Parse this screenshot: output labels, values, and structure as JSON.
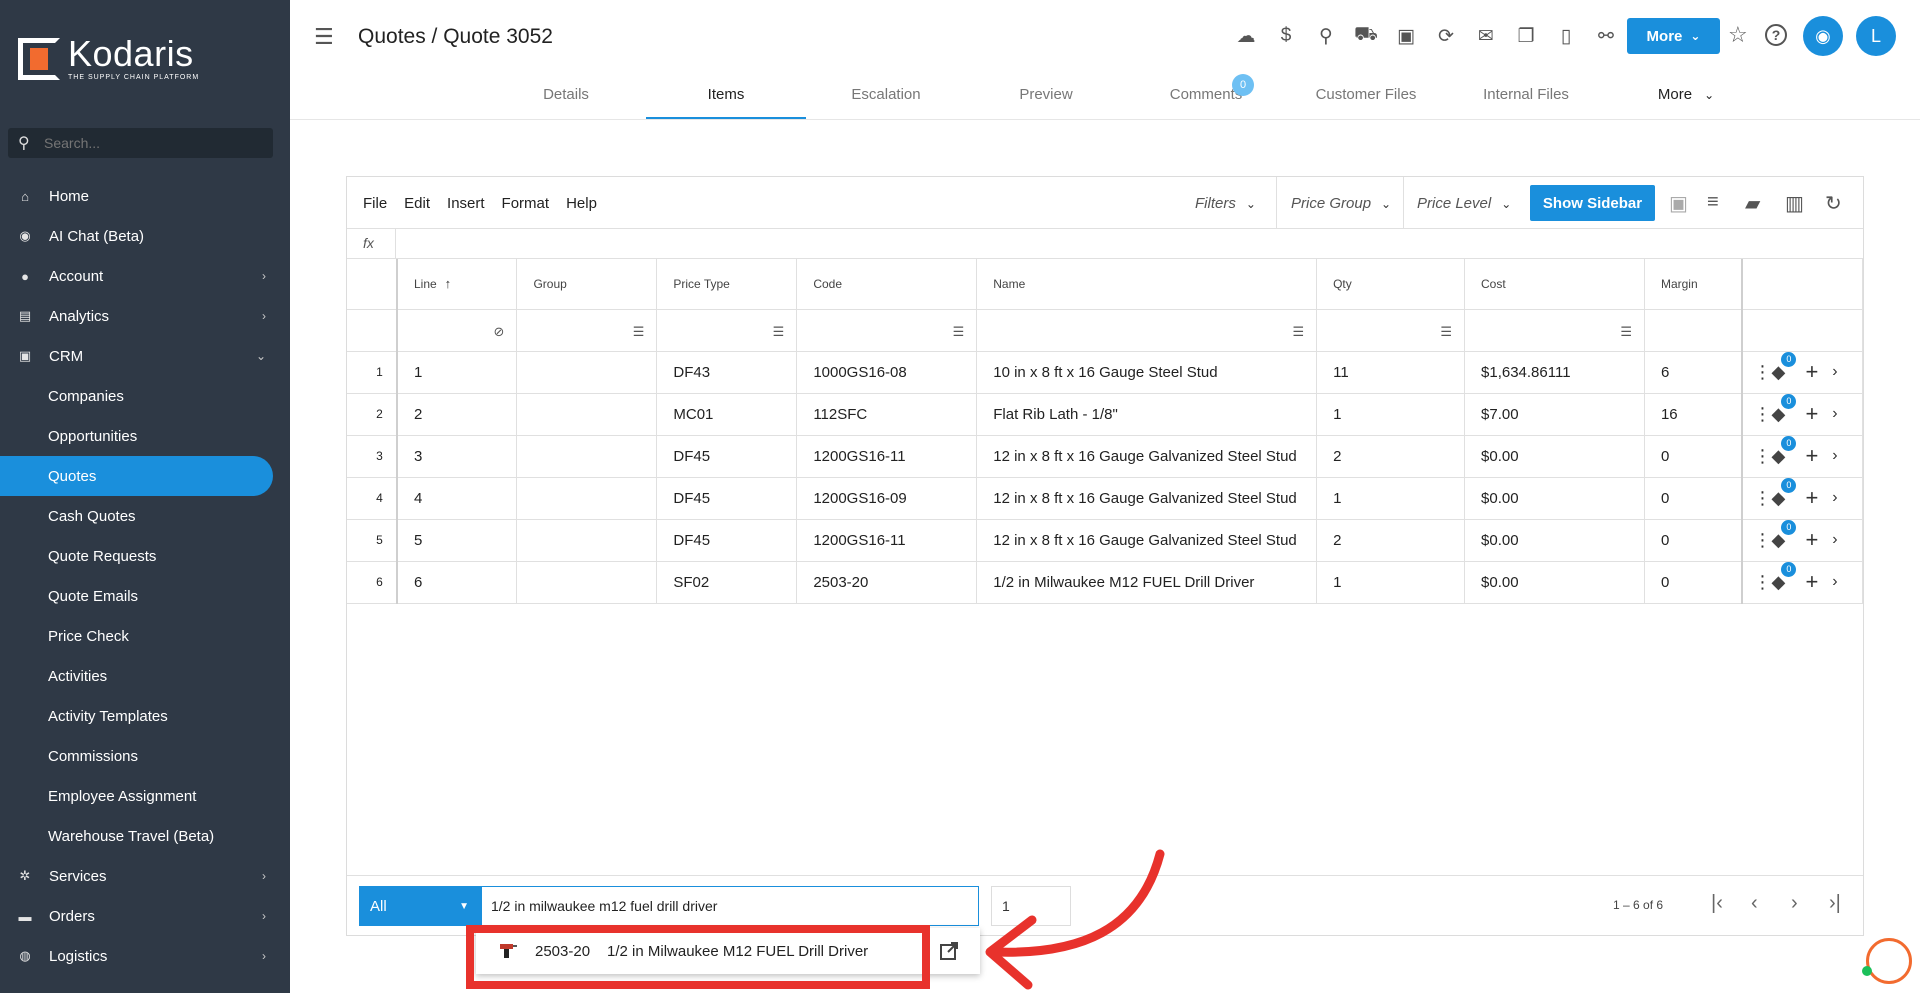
{
  "brand": {
    "name": "Kodaris",
    "tagline": "THE SUPPLY CHAIN PLATFORM",
    "accent": "#1a8fdc",
    "logo_orange": "#f26b2f",
    "sidebar_bg": "#2f3946"
  },
  "sidebar": {
    "search_placeholder": "Search...",
    "items": [
      {
        "label": "Home",
        "icon": "home-icon",
        "glyph": "⌂",
        "chevron": ""
      },
      {
        "label": "AI Chat (Beta)",
        "icon": "robot-icon",
        "glyph": "◉",
        "chevron": ""
      },
      {
        "label": "Account",
        "icon": "user-icon",
        "glyph": "●",
        "chevron": "›"
      },
      {
        "label": "Analytics",
        "icon": "chart-icon",
        "glyph": "▤",
        "chevron": "›"
      },
      {
        "label": "CRM",
        "icon": "crm-icon",
        "glyph": "▣",
        "chevron": "⌄"
      },
      {
        "label": "Companies",
        "sub": true
      },
      {
        "label": "Opportunities",
        "sub": true
      },
      {
        "label": "Quotes",
        "sub": true,
        "active": true
      },
      {
        "label": "Cash Quotes",
        "sub": true
      },
      {
        "label": "Quote Requests",
        "sub": true
      },
      {
        "label": "Quote Emails",
        "sub": true
      },
      {
        "label": "Price Check",
        "sub": true
      },
      {
        "label": "Activities",
        "sub": true
      },
      {
        "label": "Activity Templates",
        "sub": true
      },
      {
        "label": "Commissions",
        "sub": true
      },
      {
        "label": "Employee Assignment",
        "sub": true
      },
      {
        "label": "Warehouse Travel (Beta)",
        "sub": true
      },
      {
        "label": "Services",
        "icon": "gears-icon",
        "glyph": "✲",
        "chevron": "›"
      },
      {
        "label": "Orders",
        "icon": "truck-icon",
        "glyph": "▬",
        "chevron": "›"
      },
      {
        "label": "Logistics",
        "icon": "globe-icon",
        "glyph": "◍",
        "chevron": "›"
      }
    ]
  },
  "header": {
    "title": "Quotes / Quote 3052",
    "more_label": "More",
    "avatar_initial": "L",
    "toolbar_icons": [
      {
        "name": "cloud-upload-icon",
        "glyph": "☁"
      },
      {
        "name": "dollar-icon",
        "glyph": "$"
      },
      {
        "name": "location-pin-icon",
        "glyph": "⚲"
      },
      {
        "name": "delivery-truck-icon",
        "glyph": "⛟"
      },
      {
        "name": "cash-icon",
        "glyph": "▣"
      },
      {
        "name": "sync-dollar-icon",
        "glyph": "⟳"
      },
      {
        "name": "mail-icon",
        "glyph": "✉"
      },
      {
        "name": "copy-icon",
        "glyph": "❐"
      },
      {
        "name": "new-file-icon",
        "glyph": "▯"
      },
      {
        "name": "attachment-icon",
        "glyph": "⚯"
      }
    ],
    "tabs": [
      {
        "label": "Details"
      },
      {
        "label": "Items",
        "active": true
      },
      {
        "label": "Escalation"
      },
      {
        "label": "Preview"
      },
      {
        "label": "Comments",
        "badge": "0"
      },
      {
        "label": "Customer Files"
      },
      {
        "label": "Internal Files"
      },
      {
        "label": "More",
        "chevron": true
      }
    ]
  },
  "grid": {
    "menus": [
      "File",
      "Edit",
      "Insert",
      "Format",
      "Help"
    ],
    "dropdowns": {
      "filters": "Filters",
      "price_group": "Price Group",
      "price_level": "Price Level"
    },
    "show_sidebar_label": "Show Sidebar",
    "fx_label": "fx",
    "columns": [
      "Line",
      "Group",
      "Price Type",
      "Code",
      "Name",
      "Qty",
      "Cost",
      "Margin"
    ],
    "rows": [
      {
        "n": "1",
        "line": "1",
        "group": "",
        "price_type": "DF43",
        "code": "1000GS16-08",
        "name": "10 in x 8 ft x 16 Gauge Steel Stud",
        "qty": "11",
        "cost": "$1,634.86111",
        "margin": "6",
        "badge": "0"
      },
      {
        "n": "2",
        "line": "2",
        "group": "",
        "price_type": "MC01",
        "code": "112SFC",
        "name": "Flat Rib Lath - 1/8\"",
        "qty": "1",
        "cost": "$7.00",
        "margin": "16",
        "badge": "0"
      },
      {
        "n": "3",
        "line": "3",
        "group": "",
        "price_type": "DF45",
        "code": "1200GS16-11",
        "name": "12 in x 8 ft x 16 Gauge Galvanized Steel Stud",
        "qty": "2",
        "cost": "$0.00",
        "margin": "0",
        "badge": "0"
      },
      {
        "n": "4",
        "line": "4",
        "group": "",
        "price_type": "DF45",
        "code": "1200GS16-09",
        "name": "12 in x 8 ft x 16 Gauge Galvanized Steel Stud",
        "qty": "1",
        "cost": "$0.00",
        "margin": "0",
        "badge": "0"
      },
      {
        "n": "5",
        "line": "5",
        "group": "",
        "price_type": "DF45",
        "code": "1200GS16-11",
        "name": "12 in x 8 ft x 16 Gauge Galvanized Steel Stud",
        "qty": "2",
        "cost": "$0.00",
        "margin": "0",
        "badge": "0"
      },
      {
        "n": "6",
        "line": "6",
        "group": "",
        "price_type": "SF02",
        "code": "2503-20",
        "name": "1/2 in Milwaukee M12 FUEL Drill Driver",
        "qty": "1",
        "cost": "$0.00",
        "margin": "0",
        "badge": "0"
      }
    ],
    "footer": {
      "type_select": "All",
      "add_input_value": "1/2 in milwaukee m12 fuel drill driver",
      "qty_value": "1",
      "pager_text": "1 – 6 of 6"
    },
    "suggestion": {
      "code": "2503-20",
      "name": "1/2 in Milwaukee M12 FUEL Drill Driver"
    }
  },
  "annotation": {
    "color": "#e8322c"
  }
}
